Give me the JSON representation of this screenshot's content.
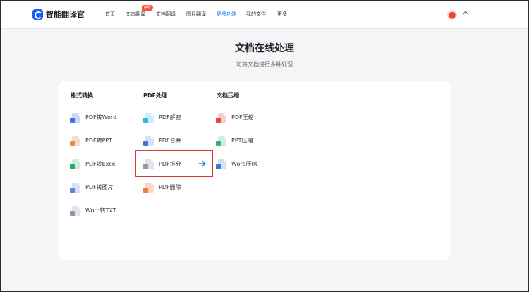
{
  "header": {
    "brand": "智能翻译官",
    "nav": [
      {
        "label": "首页"
      },
      {
        "label": "文本翻译",
        "badge": "推荐"
      },
      {
        "label": "文档翻译"
      },
      {
        "label": "图片翻译"
      },
      {
        "label": "更多功能",
        "active": true
      },
      {
        "label": "我的文件"
      },
      {
        "label": "更多"
      }
    ],
    "icons": [
      "app-logo-icon",
      "avatar",
      "chevron-up-icon"
    ]
  },
  "main": {
    "title": "文档在线处理",
    "subtitle": "可将文档进行多种处理"
  },
  "columns": [
    {
      "title": "格式转换",
      "tools": [
        {
          "label": "PDF转Word",
          "icon": "word-file-icon"
        },
        {
          "label": "PDF转PPT",
          "icon": "ppt-file-icon"
        },
        {
          "label": "PDF转Excel",
          "icon": "excel-file-icon"
        },
        {
          "label": "PDF转图片",
          "icon": "image-file-icon"
        },
        {
          "label": "Word转TXT",
          "icon": "txt-file-icon"
        }
      ]
    },
    {
      "title": "PDF处理",
      "tools": [
        {
          "label": "PDF解密",
          "icon": "lock-file-icon"
        },
        {
          "label": "PDF合并",
          "icon": "merge-file-icon"
        },
        {
          "label": "PDF拆分",
          "icon": "split-file-icon",
          "highlighted": true
        },
        {
          "label": "PDF删除",
          "icon": "delete-file-icon"
        }
      ]
    },
    {
      "title": "文档压缩",
      "tools": [
        {
          "label": "PDF压缩",
          "icon": "pdf-compress-icon"
        },
        {
          "label": "PPT压缩",
          "icon": "ppt-compress-icon"
        },
        {
          "label": "Word压缩",
          "icon": "word-compress-icon"
        }
      ]
    }
  ],
  "colors": {
    "accent": "#1d6cf5",
    "highlight_border": "#d9363e",
    "badge": "#ff4d3a",
    "background": "#f4f5f7"
  }
}
